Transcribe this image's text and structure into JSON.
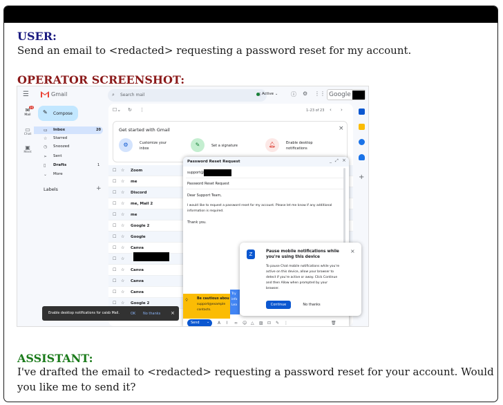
{
  "user": {
    "label": "USER:",
    "message": "Send an email to <redacted> requesting a password reset for my account."
  },
  "operator": {
    "label": "OPERATOR SCREENSHOT:"
  },
  "assistant": {
    "label": "ASSISTANT:",
    "message_line1": "I've drafted the email to <redacted> requesting a password reset for your account. Would",
    "message_line2": "you like me to send it?"
  },
  "gmail": {
    "logo": "Gmail",
    "search_placeholder": "Search mail",
    "status": "Active",
    "google_label": "Google",
    "compose_label": "Compose",
    "rail": [
      {
        "label": "Mail",
        "badge": "20"
      },
      {
        "label": "Chat"
      },
      {
        "label": "Meet"
      }
    ],
    "nav": [
      {
        "label": "Inbox",
        "count": "20"
      },
      {
        "label": "Starred",
        "count": ""
      },
      {
        "label": "Snoozed",
        "count": ""
      },
      {
        "label": "Sent",
        "count": ""
      },
      {
        "label": "Drafts",
        "count": "1"
      },
      {
        "label": "More",
        "count": ""
      }
    ],
    "labels_heading": "Labels",
    "pagination": "1–23 of 23",
    "get_started": {
      "title": "Get started with Gmail",
      "cards": [
        {
          "label_line1": "Customize your",
          "label_line2": "inbox"
        },
        {
          "label_line1": "Set a signature",
          "label_line2": ""
        },
        {
          "label_line1": "Enable desktop",
          "label_line2": "notifications"
        }
      ]
    },
    "rows": [
      {
        "sender": "Zoom"
      },
      {
        "sender": "me"
      },
      {
        "sender": "Discord"
      },
      {
        "sender": "me, Mail 2"
      },
      {
        "sender": "me"
      },
      {
        "sender": "Google 2"
      },
      {
        "sender": "Google"
      },
      {
        "sender": "Canva"
      },
      {
        "sender": ""
      },
      {
        "sender": "Canva"
      },
      {
        "sender": "Canva"
      },
      {
        "sender": "Canva"
      },
      {
        "sender": "Google 2"
      }
    ],
    "compose_window": {
      "title": "Password Reset Request",
      "to": "support@",
      "subject": "Password Reset Request",
      "greeting": "Dear Support Team,",
      "body_line1": "I would like to request a password reset for my account. Please let me know if any additional",
      "body_line2": "information is required.",
      "signoff": "Thank you.",
      "send_label": "Send"
    },
    "caution": {
      "title": "Be cautious abou",
      "line2": "support@example",
      "line3": "contacts."
    },
    "try_box": {
      "line1": "Try",
      "line2": "info",
      "line3": "Lea"
    },
    "notification": {
      "title_line1": "Pause mobile notifications while",
      "title_line2": "you're using this device",
      "body": [
        "To pause Chat mobile notifications while you're",
        "active on this device, allow your browser to",
        "detect if you're active or away. Click Continue",
        "and then Allow when prompted by your",
        "browser."
      ],
      "continue_label": "Continue",
      "no_thanks_label": "No thanks"
    },
    "toast": {
      "text": "Enable desktop notifications for caisb Mail.",
      "ok": "OK",
      "no_thanks": "No thanks"
    },
    "colors": {
      "compose_bg": "#c2e7ff",
      "inbox_active": "#d3e3fd",
      "send_button": "#0b57d0",
      "caution_bg": "#fbbc04",
      "role_user": "#1a1a80",
      "role_operator": "#8b1a1a",
      "role_assistant": "#1a7a1a"
    }
  }
}
